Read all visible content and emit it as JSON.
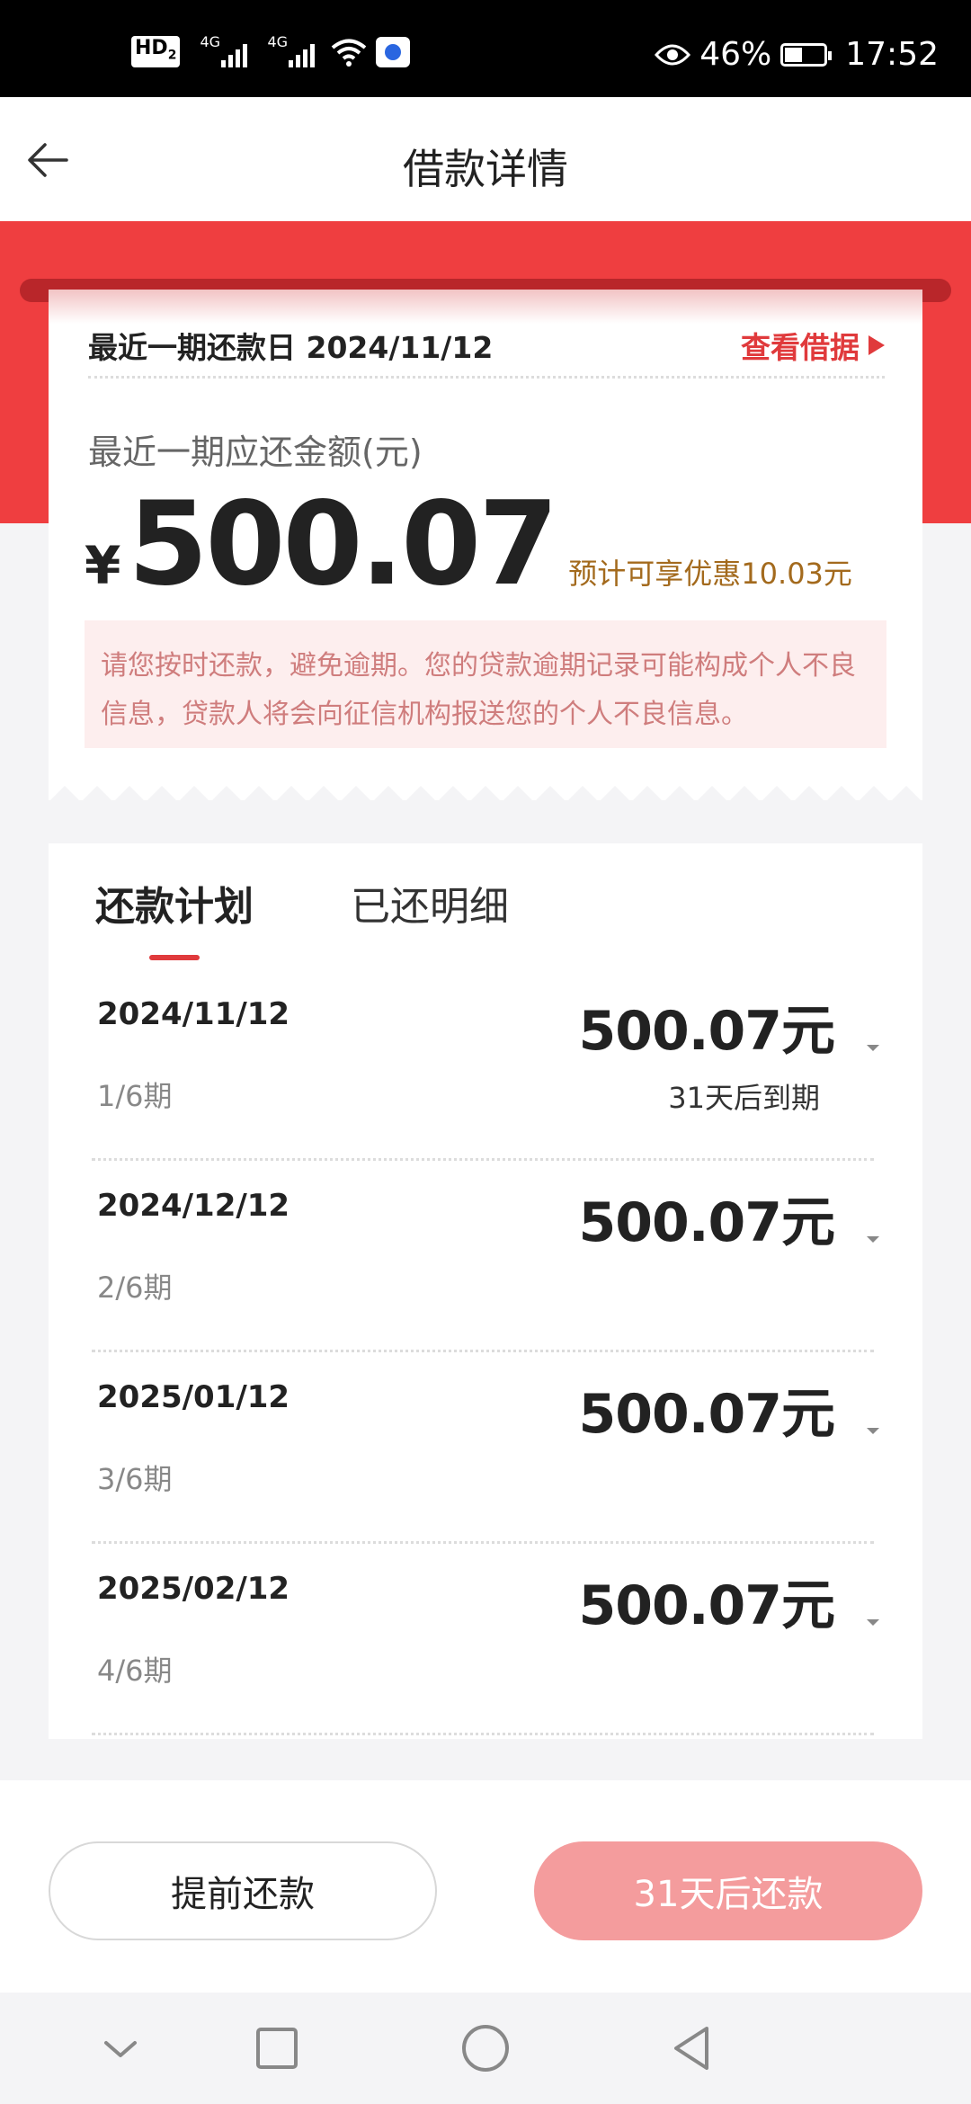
{
  "status_bar": {
    "hd_label": "HD",
    "hd_sub": "2",
    "signal1_label": "4G",
    "signal2_label": "4G",
    "battery_percent": "46%",
    "battery_level": 0.46,
    "time": "17:52",
    "icons": [
      "hd-icon",
      "signal-icon",
      "signal-icon",
      "wifi-icon",
      "baidu-app-icon",
      "eye-icon",
      "battery-icon"
    ]
  },
  "header": {
    "title": "借款详情",
    "back_icon": "arrow-left-icon"
  },
  "summary": {
    "due_date_label": "最近一期还款日 2024/11/12",
    "voucher_link": "查看借据",
    "amount_label": "最近一期应还金额(元)",
    "currency_symbol": "¥",
    "amount": "500.07",
    "discount_text": "预计可享优惠10.03元",
    "warning_line1": "请您按时还款，避免逾期。您的贷款逾期记录可能构成个人不良",
    "warning_line2": "信息，贷款人将会向征信机构报送您的个人不良信息。"
  },
  "tabs": {
    "plan": "还款计划",
    "paid": "已还明细"
  },
  "schedule": [
    {
      "date": "2024/11/12",
      "term": "1/6期",
      "amount": "500.07元",
      "note": "31天后到期"
    },
    {
      "date": "2024/12/12",
      "term": "2/6期",
      "amount": "500.07元",
      "note": ""
    },
    {
      "date": "2025/01/12",
      "term": "3/6期",
      "amount": "500.07元",
      "note": ""
    },
    {
      "date": "2025/02/12",
      "term": "4/6期",
      "amount": "500.07元",
      "note": ""
    }
  ],
  "actions": {
    "prepay": "提前还款",
    "repay": "31天后还款"
  },
  "colors": {
    "accent_red": "#ef3e40",
    "button_disabled_red": "#f49c9d",
    "discount_gold": "#a36a1d",
    "warning_bg": "#fdeeee"
  },
  "nav_icons": [
    "chevron-down-icon",
    "square-icon",
    "circle-icon",
    "triangle-back-icon"
  ]
}
